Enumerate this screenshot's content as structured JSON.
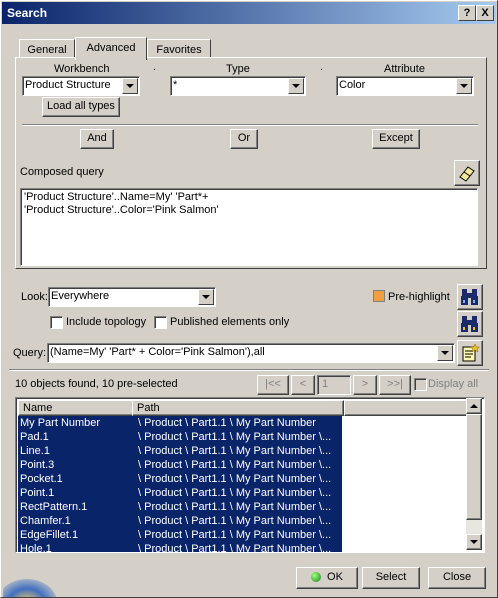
{
  "window": {
    "title": "Search",
    "help_button": "?",
    "close_button": "X"
  },
  "tabs": [
    "General",
    "Advanced",
    "Favorites"
  ],
  "advanced": {
    "workbench_label": "Workbench",
    "type_label": "Type",
    "attribute_label": "Attribute",
    "workbench_value": "Product Structure",
    "type_value": "*",
    "attribute_value": "Color",
    "load_all_label": "Load all types",
    "and_label": "And",
    "or_label": "Or",
    "except_label": "Except",
    "separator_dot": "."
  },
  "composed_query": {
    "label": "Composed query",
    "lines": [
      "'Product Structure'..Name=My' 'Part*+",
      "'Product Structure'..Color='Pink Salmon'"
    ]
  },
  "look": {
    "label": "Look:",
    "value": "Everywhere",
    "prehighlight_label": "Pre-highlight",
    "include_topology_label": "Include topology",
    "published_only_label": "Published elements only"
  },
  "query": {
    "label": "Query:",
    "value": "(Name=My' 'Part* + Color='Pink Salmon'),all"
  },
  "results": {
    "status": "10 objects found, 10 pre-selected",
    "page_value": "1",
    "nav_first": "|<<",
    "nav_prev": "<",
    "nav_next": ">",
    "nav_last": ">>|",
    "display_all_label": "Display all",
    "columns": [
      "Name",
      "Path"
    ],
    "rows": [
      {
        "name": "My Part Number",
        "path": "\\ Product \\ Part1.1 \\ My Part Number"
      },
      {
        "name": "Pad.1",
        "path": "\\ Product \\ Part1.1 \\ My Part Number \\..."
      },
      {
        "name": "Line.1",
        "path": "\\ Product \\ Part1.1 \\ My Part Number \\..."
      },
      {
        "name": "Point.3",
        "path": "\\ Product \\ Part1.1 \\ My Part Number \\..."
      },
      {
        "name": "Pocket.1",
        "path": "\\ Product \\ Part1.1 \\ My Part Number \\..."
      },
      {
        "name": "Point.1",
        "path": "\\ Product \\ Part1.1 \\ My Part Number \\..."
      },
      {
        "name": "RectPattern.1",
        "path": "\\ Product \\ Part1.1 \\ My Part Number \\..."
      },
      {
        "name": "Chamfer.1",
        "path": "\\ Product \\ Part1.1 \\ My Part Number \\..."
      },
      {
        "name": "EdgeFillet.1",
        "path": "\\ Product \\ Part1.1 \\ My Part Number \\..."
      },
      {
        "name": "Hole.1",
        "path": "\\ Product \\ Part1.1 \\ My Part Number \\..."
      }
    ]
  },
  "footer": {
    "ok_label": "OK",
    "select_label": "Select",
    "close_label": "Close"
  }
}
